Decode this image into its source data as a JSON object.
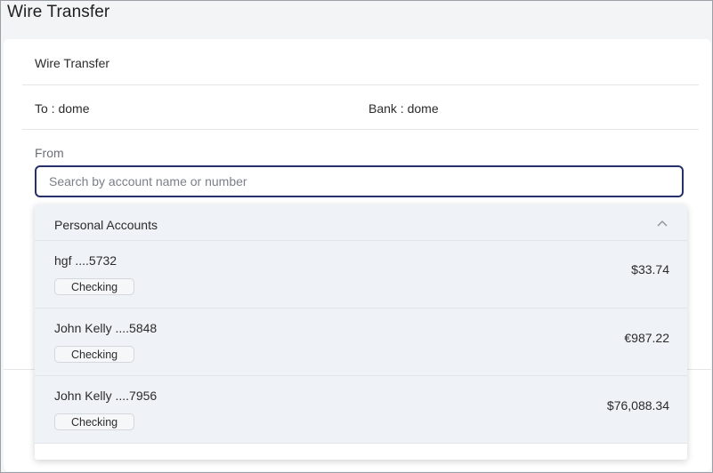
{
  "page": {
    "title": "Wire Transfer"
  },
  "card": {
    "title": "Wire Transfer",
    "to_label": "To : dome",
    "bank_label": "Bank : dome",
    "from_label": "From",
    "search_placeholder": "Search by account name or number"
  },
  "dropdown": {
    "group_label": "Personal Accounts",
    "expanded": true,
    "accounts": [
      {
        "name": "hgf ....5732",
        "type": "Checking",
        "balance": "$33.74"
      },
      {
        "name": "John Kelly ....5848",
        "type": "Checking",
        "balance": "€987.22"
      },
      {
        "name": "John Kelly ....7956",
        "type": "Checking",
        "balance": "$76,088.34"
      }
    ]
  },
  "icons": {
    "group_toggle": "chevron-up-icon"
  },
  "colors": {
    "input_border": "#26306b",
    "dropdown_bg": "#eff2f6"
  }
}
